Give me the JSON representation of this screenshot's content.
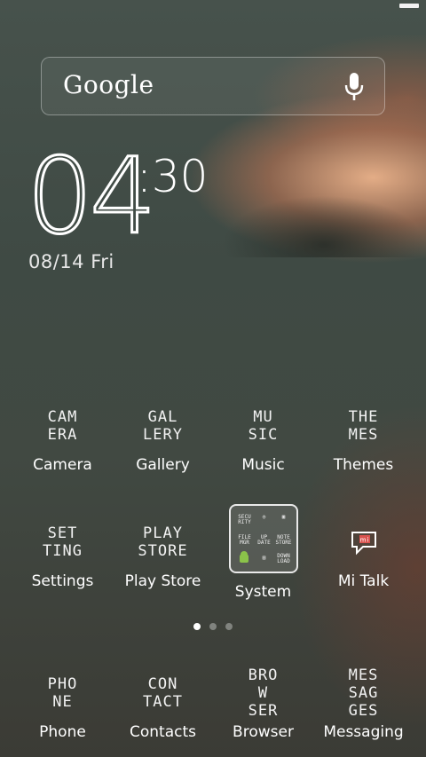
{
  "search_widget": {
    "label": "Google"
  },
  "clock": {
    "hour": "04",
    "minute": ":30",
    "date": "08/14  Fri"
  },
  "apps_row1": [
    {
      "icon_text": [
        "CAM",
        "ERA"
      ],
      "label": "Camera"
    },
    {
      "icon_text": [
        "GAL",
        "LERY"
      ],
      "label": "Gallery"
    },
    {
      "icon_text": [
        "MU",
        "SIC"
      ],
      "label": "Music"
    },
    {
      "icon_text": [
        "THE",
        "MES"
      ],
      "label": "Themes"
    }
  ],
  "apps_row2": [
    {
      "icon_text": [
        "SET",
        "TING"
      ],
      "label": "Settings"
    },
    {
      "icon_text": [
        "PLAY",
        "STORE"
      ],
      "label": "Play Store"
    },
    {
      "icon_text": [],
      "label": "System"
    },
    {
      "icon_text": [],
      "label": "Mi Talk"
    }
  ],
  "folder_minis": [
    "SECU RITY",
    "",
    "",
    "FILE MGR",
    "UP DATE",
    "NOTE STORE",
    "",
    "",
    "DOWN LOAD"
  ],
  "dock": [
    {
      "icon_text": [
        "PHO",
        "NE"
      ],
      "label": "Phone"
    },
    {
      "icon_text": [
        "CON",
        "TACT"
      ],
      "label": "Contacts"
    },
    {
      "icon_text": [
        "BRO",
        "W",
        "SER"
      ],
      "label": "Browser"
    },
    {
      "icon_text": [
        "MES",
        "SAG",
        "GES"
      ],
      "label": "Messaging"
    }
  ],
  "page_indicator": {
    "count": 3,
    "active": 0
  }
}
